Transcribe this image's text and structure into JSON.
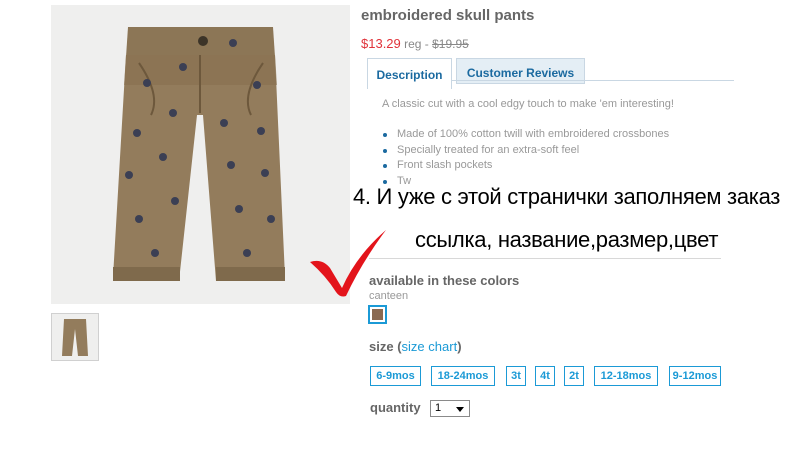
{
  "product": {
    "title": "embroidered skull pants",
    "sale_price": "$13.29",
    "reg_label": " reg - ",
    "reg_price": "$19.95"
  },
  "tabs": [
    {
      "label": "Description"
    },
    {
      "label": "Customer Reviews"
    }
  ],
  "description": {
    "intro": "A classic cut with a cool edgy touch to make 'em interesting!",
    "features": [
      "Made of 100% cotton twill with embroidered crossbones",
      "Specially treated for an extra-soft feel",
      "Front slash pockets",
      "Tw"
    ]
  },
  "annotation": {
    "line1": "4. И уже с этой странички заполняем заказ",
    "line2": "ссылка, название,размер,цвет",
    "color": "#000000"
  },
  "colors": {
    "label": "available in these colors",
    "selected_name": "canteen",
    "swatch_color": "#8a6a52"
  },
  "size": {
    "label": "size",
    "chart_link": "size chart",
    "open_paren": "(",
    "close_paren": ")",
    "options": [
      "6-9mos",
      "18-24mos",
      "3t",
      "4t",
      "2t",
      "12-18mos",
      "9-12mos"
    ]
  },
  "quantity": {
    "label": "quantity",
    "value": "1"
  },
  "theme": {
    "link_blue": "#1b9ad6",
    "sale_red": "#e0323a"
  }
}
